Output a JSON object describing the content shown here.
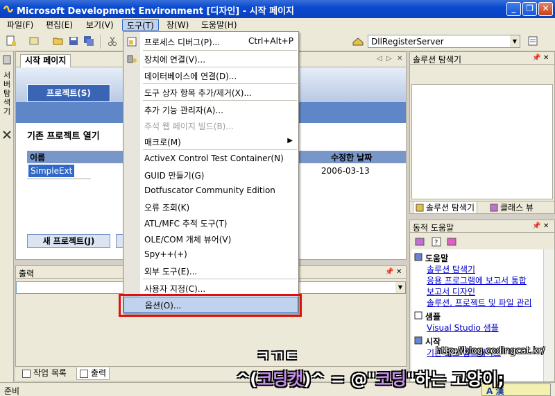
{
  "window": {
    "title": "Microsoft Development Environment [디자인] - 시작 페이지",
    "minimize": "_",
    "restore": "❐",
    "close": "✕"
  },
  "menubar": {
    "items": [
      "파일(F)",
      "편집(E)",
      "보기(V)",
      "도구(T)",
      "창(W)",
      "도움말(H)"
    ],
    "active_index": 3
  },
  "toolbar": {
    "combo_value": "DllRegisterServer"
  },
  "left_strip": {
    "server_explorer_label": "서버 탐색기"
  },
  "start_page": {
    "tab_label": "시작 페이지",
    "projects_tab": "프로젝트(S)",
    "open_existing_title": "기존 프로젝트 열기",
    "columns": {
      "name": "이름",
      "modified": "수정한 날짜"
    },
    "rows": [
      {
        "name": "SimpleExt",
        "modified": "2006-03-13"
      }
    ],
    "new_project_button": "새 프로젝트(J)"
  },
  "output_panel": {
    "title": "출력"
  },
  "bottom_tabs": [
    "작업 목록",
    "출력"
  ],
  "status": {
    "text": "준비",
    "ime": "A 漢"
  },
  "solution_explorer": {
    "title": "솔루션 탐색기",
    "tabs": [
      "솔루션 탐색기",
      "클래스 뷰"
    ]
  },
  "dynamic_help": {
    "title": "동적 도움말",
    "sections": [
      {
        "title": "도움말",
        "links": [
          "솔루션 탐색기",
          "응용 프로그램에 보고서 통합",
          "보고서 디자인",
          "솔루션, 프로젝트 및 파일 관리"
        ]
      },
      {
        "title": "샘플",
        "links": [
          "Visual Studio 샘플"
        ]
      },
      {
        "title": "시작",
        "links": [
          "기존 코드 업그레이드"
        ]
      }
    ]
  },
  "tools_menu": {
    "items": [
      {
        "label": "프로세스 디버그(P)...",
        "shortcut": "Ctrl+Alt+P"
      },
      {
        "label": "장치에 연결(V)..."
      },
      {
        "label": "데이터베이스에 연결(D)..."
      },
      {
        "label": "도구 상자 항목 추가/제거(X)..."
      },
      {
        "label": "추가 기능 관리자(A)..."
      },
      {
        "label": "주석 웹 페이지 빌드(B)...",
        "disabled": true
      },
      {
        "label": "매크로(M)",
        "submenu": true
      },
      {
        "label": "ActiveX Control Test Container(N)"
      },
      {
        "label": "GUID 만들기(G)"
      },
      {
        "label": "Dotfuscator Community Edition"
      },
      {
        "label": "오류 조회(K)"
      },
      {
        "label": "ATL/MFC 추적 도구(T)"
      },
      {
        "label": "OLE/COM 개체 뷰어(V)"
      },
      {
        "label": "Spy++(+)"
      },
      {
        "label": "외부 도구(E)..."
      },
      {
        "label": "사용자 지정(C)..."
      },
      {
        "label": "옵션(O)...",
        "highlighted": true
      }
    ]
  },
  "watermark": {
    "logo": "ㅋㄲㅌ",
    "url": "http://blog.codingcat.kr/",
    "line_prefix": "^(",
    "line_name": "코딩캣",
    "line_mid": ")^ = @\"",
    "line_code": "코딩",
    "line_suffix": "\"하는 고양이;"
  },
  "colors": {
    "titlebar": "#0a4ad0",
    "highlight": "#c1d2ee",
    "redbox": "#e0100c",
    "link": "#0000cc"
  }
}
